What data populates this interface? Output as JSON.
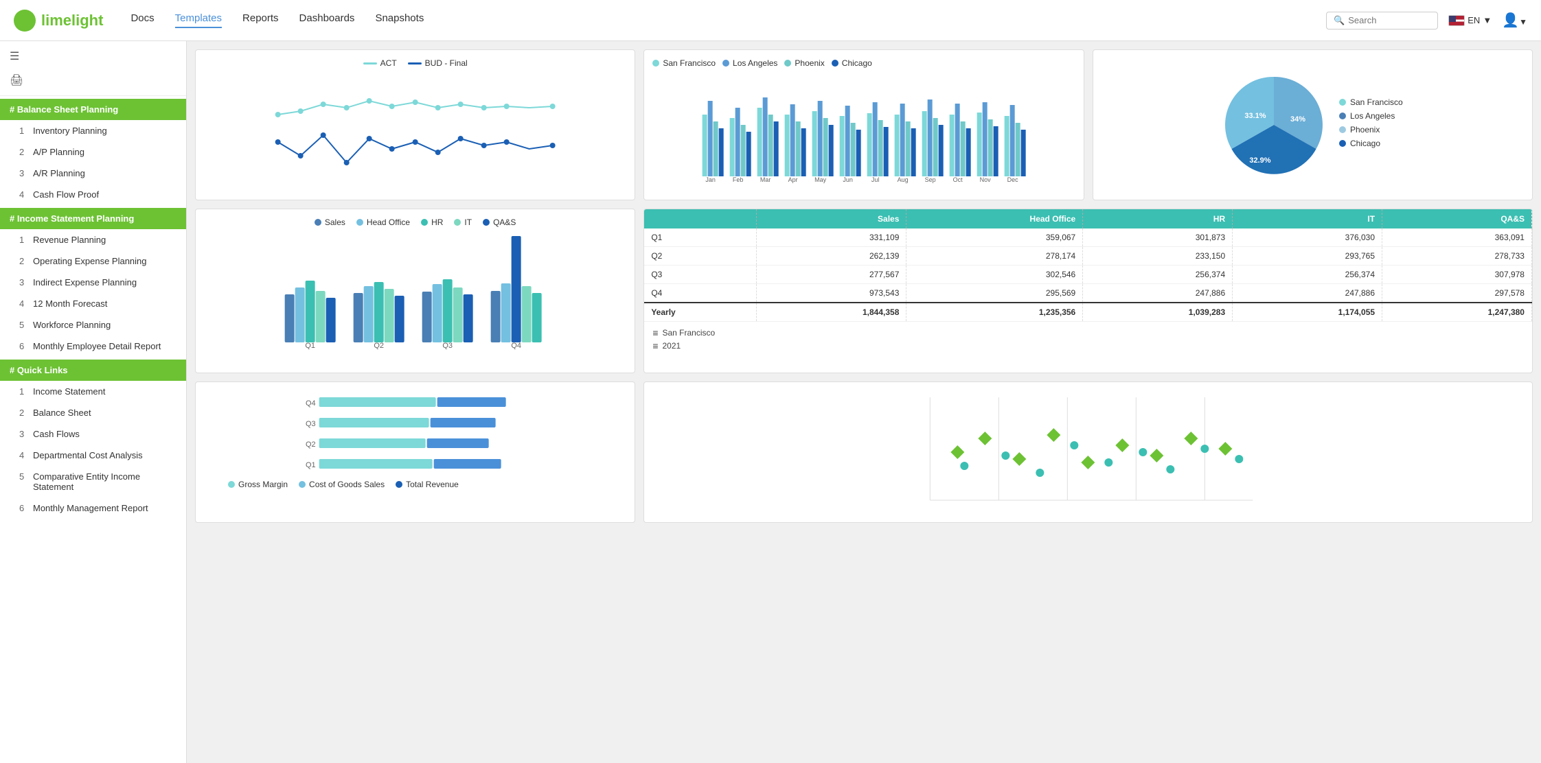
{
  "header": {
    "logo_text": "limelight",
    "nav": [
      {
        "label": "Docs",
        "active": false
      },
      {
        "label": "Templates",
        "active": true
      },
      {
        "label": "Reports",
        "active": false
      },
      {
        "label": "Dashboards",
        "active": false
      },
      {
        "label": "Snapshots",
        "active": false
      }
    ],
    "search_placeholder": "Search",
    "lang": "EN",
    "search_label": "Search"
  },
  "sidebar": {
    "balance_sheet_header": "# Balance Sheet Planning",
    "balance_sheet_items": [
      {
        "num": "1",
        "label": "Inventory Planning"
      },
      {
        "num": "2",
        "label": "A/P Planning"
      },
      {
        "num": "3",
        "label": "A/R Planning"
      },
      {
        "num": "4",
        "label": "Cash Flow Proof"
      }
    ],
    "income_statement_header": "# Income Statement Planning",
    "income_statement_items": [
      {
        "num": "1",
        "label": "Revenue Planning"
      },
      {
        "num": "2",
        "label": "Operating Expense Planning"
      },
      {
        "num": "3",
        "label": "Indirect Expense Planning"
      },
      {
        "num": "4",
        "label": "12 Month Forecast"
      },
      {
        "num": "5",
        "label": "Workforce Planning"
      },
      {
        "num": "6",
        "label": "Monthly Employee Detail Report"
      }
    ],
    "quick_links_header": "# Quick Links",
    "quick_links_items": [
      {
        "num": "1",
        "label": "Income Statement"
      },
      {
        "num": "2",
        "label": "Balance Sheet"
      },
      {
        "num": "3",
        "label": "Cash Flows"
      },
      {
        "num": "4",
        "label": "Departmental Cost Analysis"
      },
      {
        "num": "5",
        "label": "Comparative Entity Income Statement"
      },
      {
        "num": "6",
        "label": "Monthly Management Report"
      }
    ]
  },
  "chart1": {
    "legend": [
      {
        "label": "ACT",
        "color": "#7dd8d8"
      },
      {
        "label": "BUD - Final",
        "color": "#1a5fb4"
      }
    ]
  },
  "chart2": {
    "months": [
      "Jan",
      "Feb",
      "Mar",
      "Apr",
      "May",
      "Jun",
      "Jul",
      "Aug",
      "Sep",
      "Oct",
      "Nov",
      "Dec"
    ],
    "legend": [
      {
        "label": "San Francisco",
        "color": "#7dd8d8"
      },
      {
        "label": "Los Angeles",
        "color": "#5b9bd5"
      },
      {
        "label": "Phoenix",
        "color": "#70c9c9"
      },
      {
        "label": "Chicago",
        "color": "#1a5fb4"
      }
    ]
  },
  "chart3": {
    "segments": [
      {
        "label": "34%",
        "value": 34,
        "color": "#6baed6"
      },
      {
        "label": "33.1%",
        "value": 33.1,
        "color": "#2171b5"
      },
      {
        "label": "32.9%",
        "value": 32.9,
        "color": "#74c0e0"
      }
    ],
    "legend": [
      {
        "label": "San Francisco",
        "color": "#7dd8d8"
      },
      {
        "label": "Los Angeles",
        "color": "#4a7fb5"
      },
      {
        "label": "Phoenix",
        "color": "#9ecae1"
      },
      {
        "label": "Chicago",
        "color": "#1a5fb4"
      }
    ]
  },
  "chart4": {
    "legend": [
      {
        "label": "Sales",
        "color": "#4a7fb5"
      },
      {
        "label": "Head Office",
        "color": "#74c0e0"
      },
      {
        "label": "HR",
        "color": "#3bbfb2"
      },
      {
        "label": "IT",
        "color": "#7dd8c0"
      },
      {
        "label": "QA&S",
        "color": "#1a5fb4"
      }
    ],
    "quarters": [
      "Q1",
      "Q2",
      "Q3",
      "Q4"
    ]
  },
  "table": {
    "headers": [
      "",
      "Sales",
      "Head Office",
      "HR",
      "IT",
      "QA&S"
    ],
    "rows": [
      {
        "label": "Q1",
        "sales": "331,109",
        "head_office": "359,067",
        "hr": "301,873",
        "it": "376,030",
        "qas": "363,091"
      },
      {
        "label": "Q2",
        "sales": "262,139",
        "head_office": "278,174",
        "hr": "233,150",
        "it": "293,765",
        "qas": "278,733"
      },
      {
        "label": "Q3",
        "sales": "277,567",
        "head_office": "302,546",
        "hr": "256,374",
        "it": "256,374",
        "qas": "307,978"
      },
      {
        "label": "Q4",
        "sales": "973,543",
        "head_office": "295,569",
        "hr": "247,886",
        "it": "247,886",
        "qas": "297,578"
      }
    ],
    "yearly": {
      "label": "Yearly",
      "sales": "1,844,358",
      "head_office": "1,235,356",
      "hr": "1,039,283",
      "it": "1,174,055",
      "qas": "1,247,380"
    },
    "footer": [
      {
        "icon": "≡",
        "label": "San Francisco"
      },
      {
        "icon": "≡",
        "label": "2021"
      }
    ]
  },
  "chart5": {
    "title": "Horizontal Bar Chart",
    "legend": [
      {
        "label": "Gross Margin",
        "color": "#7dd8d8"
      },
      {
        "label": "Cost of Goods Sales",
        "color": "#74c0e0"
      },
      {
        "label": "Total Revenue",
        "color": "#1a5fb4"
      }
    ],
    "quarters": [
      "Q4",
      "Q3",
      "Q2",
      "Q1"
    ]
  },
  "chart6": {
    "title": "Scatter Plot"
  }
}
